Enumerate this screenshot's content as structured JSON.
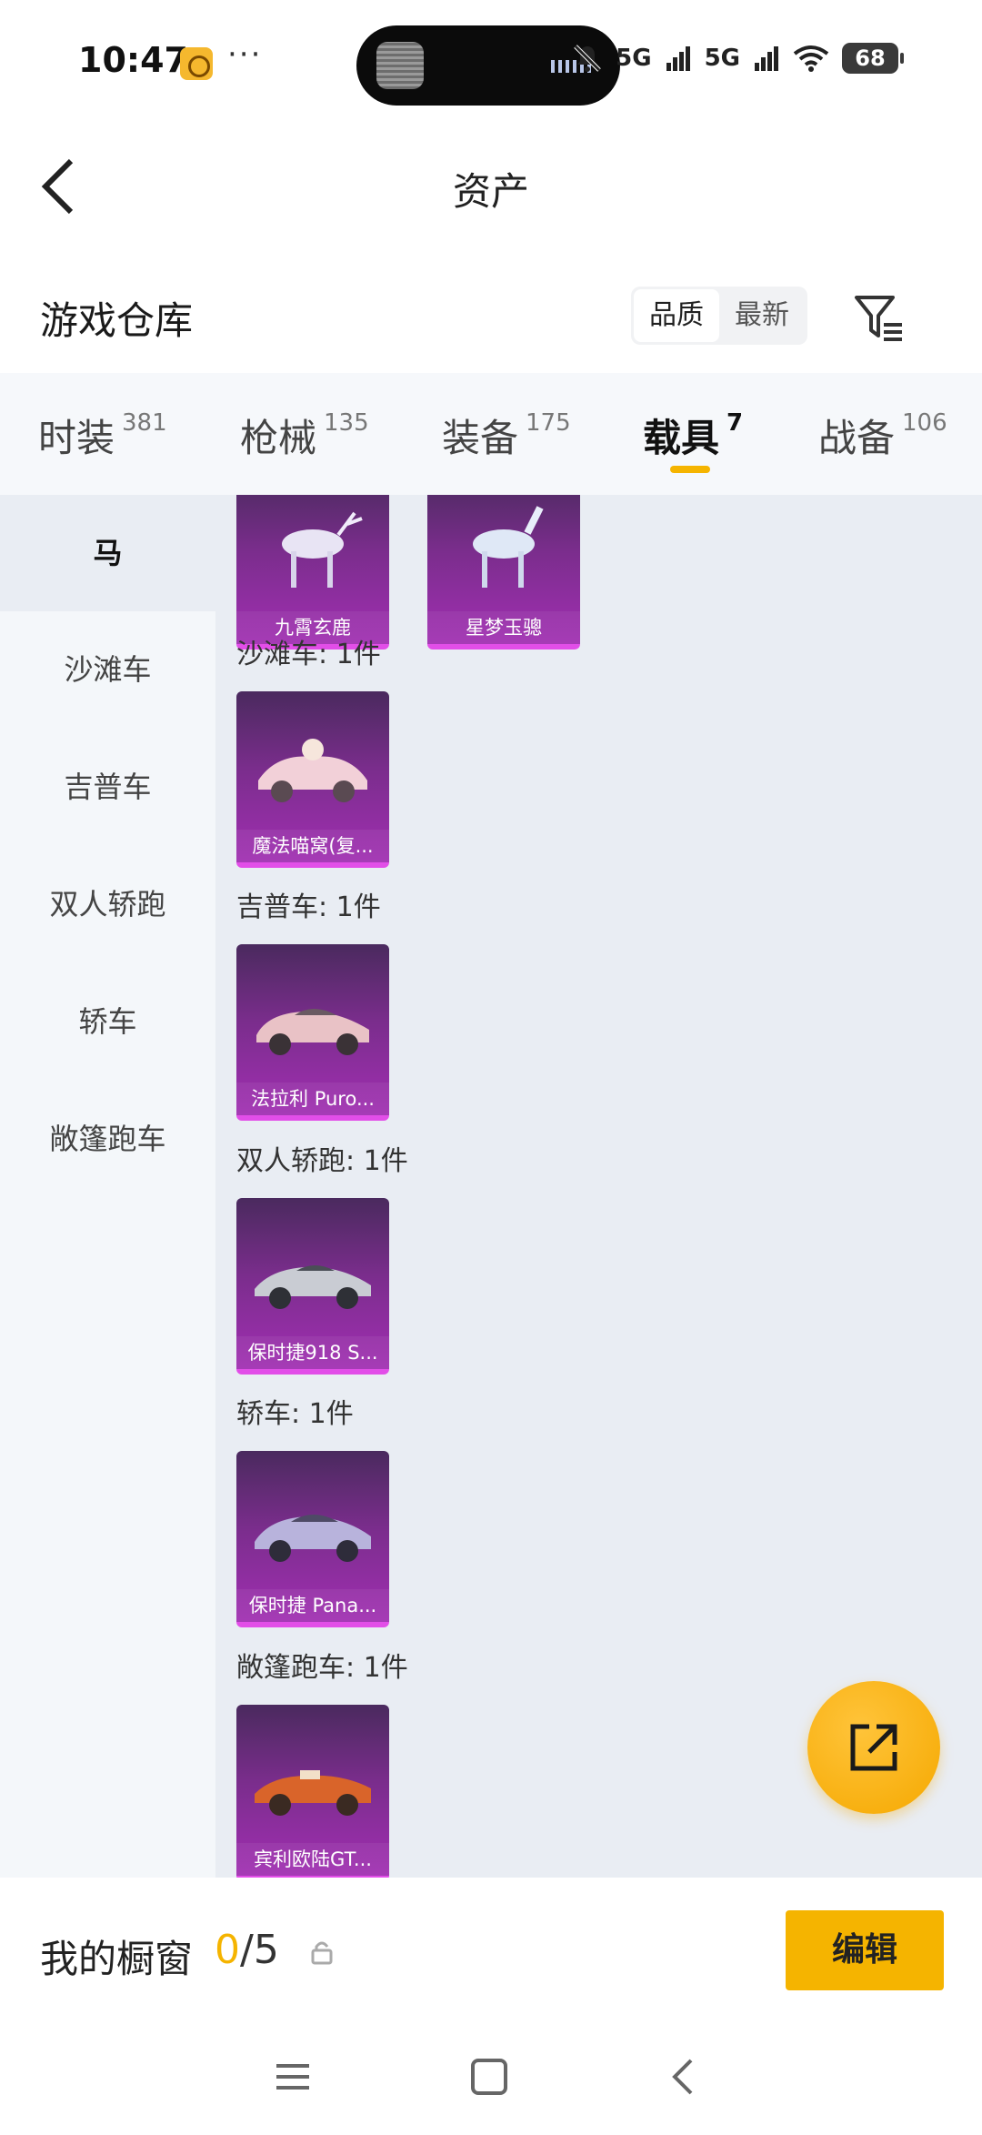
{
  "status_bar": {
    "time": "10:47",
    "more": "···",
    "signal_1": "5G",
    "signal_2": "5G",
    "battery": "68"
  },
  "header": {
    "title": "资产"
  },
  "warehouse": {
    "title": "游戏仓库",
    "sort_options": [
      "品质",
      "最新"
    ],
    "sort_selected": "品质"
  },
  "tabs": [
    {
      "label": "时装",
      "count": "381"
    },
    {
      "label": "枪械",
      "count": "135"
    },
    {
      "label": "装备",
      "count": "175"
    },
    {
      "label": "载具",
      "count": "7",
      "active": true
    },
    {
      "label": "战备",
      "count": "106"
    }
  ],
  "sidebar": {
    "items": [
      "马",
      "沙滩车",
      "吉普车",
      "双人轿跑",
      "轿车",
      "敞篷跑车"
    ],
    "active_index": 0
  },
  "content": {
    "horse_items": [
      {
        "name": "九霄玄鹿",
        "icon": "deer-mount-icon"
      },
      {
        "name": "星梦玉骢",
        "icon": "horse-mount-icon"
      }
    ],
    "sections": [
      {
        "header": "沙滩车: 1件",
        "item": "魔法喵窝(复...",
        "icon": "pink-cat-car-icon",
        "color": "#f2d0d8"
      },
      {
        "header": "吉普车: 1件",
        "item": "法拉利 Puro...",
        "icon": "pink-sports-car-icon",
        "color": "#e9c2c6"
      },
      {
        "header": "双人轿跑: 1件",
        "item": "保时捷918 S...",
        "icon": "silver-sports-car-icon",
        "color": "#c9ccd3"
      },
      {
        "header": "轿车: 1件",
        "item": "保时捷 Pana...",
        "icon": "lavender-sedan-icon",
        "color": "#b8b3dc"
      },
      {
        "header": "敞篷跑车: 1件",
        "item": "宾利欧陆GT...",
        "icon": "orange-convertible-icon",
        "color": "#d9642a"
      }
    ]
  },
  "bottom": {
    "showcase_label": "我的橱窗",
    "showcase_current": "0",
    "showcase_total": "/5",
    "edit_label": "编辑"
  },
  "colors": {
    "accent": "#f5b400",
    "card_purple": "#7a2d8c"
  }
}
